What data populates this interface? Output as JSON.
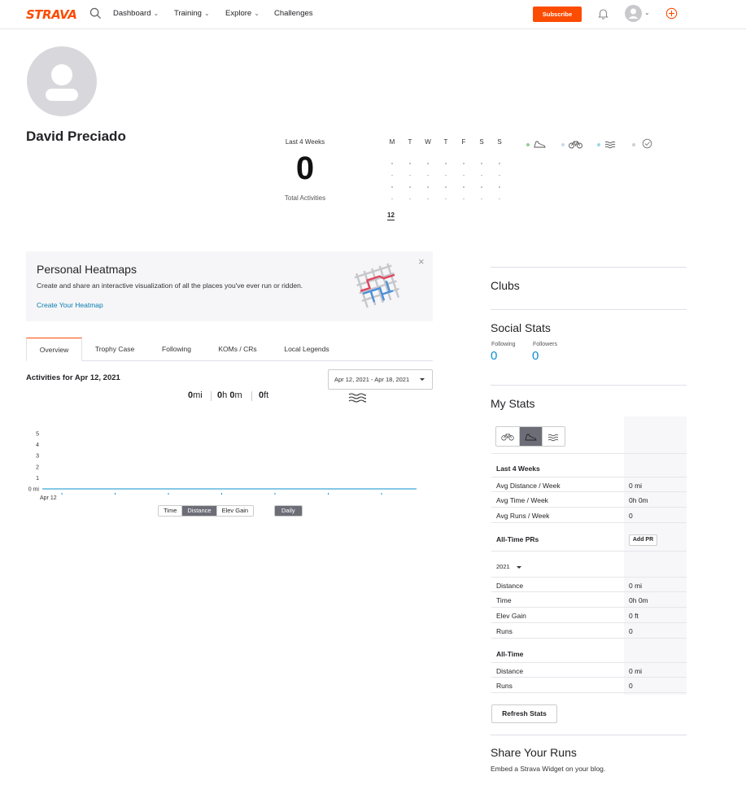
{
  "header": {
    "logo": "STRAVA",
    "nav": [
      {
        "label": "Dashboard",
        "has_dropdown": true
      },
      {
        "label": "Training",
        "has_dropdown": true
      },
      {
        "label": "Explore",
        "has_dropdown": true
      },
      {
        "label": "Challenges",
        "has_dropdown": false
      }
    ],
    "subscribe_label": "Subscribe",
    "accent": "#fc4c02"
  },
  "profile": {
    "name": "David Preciado",
    "last4weeks_label": "Last 4 Weeks",
    "last4weeks_count": "0",
    "total_activities_label": "Total Activities",
    "week_days": [
      "M",
      "T",
      "W",
      "T",
      "F",
      "S",
      "S"
    ],
    "calendar_date": "12",
    "sport_legend": [
      {
        "icon": "run-shoe-icon",
        "color": "#8fd18f"
      },
      {
        "icon": "bike-icon",
        "color": "#cfd8e8"
      },
      {
        "icon": "swim-icon",
        "color": "#9fd6ea"
      },
      {
        "icon": "other-activity-icon",
        "color": "#cfcfd4"
      }
    ]
  },
  "heatmap_banner": {
    "title": "Personal Heatmaps",
    "description": "Create and share an interactive visualization of all the places you've ever run or ridden.",
    "link": "Create Your Heatmap"
  },
  "tabs": [
    "Overview",
    "Trophy Case",
    "Following",
    "KOMs / CRs",
    "Local Legends"
  ],
  "activities": {
    "title": "Activities for Apr 12, 2021",
    "date_range": "Apr 12, 2021 - Apr 18, 2021",
    "summary": [
      {
        "num": "0",
        "unit": "mi"
      },
      {
        "num": "0",
        "unit": "h",
        "num2": "0",
        "unit2": "m"
      },
      {
        "num": "0",
        "unit": "ft"
      }
    ],
    "metric_toggle": [
      "Time",
      "Distance",
      "Elev Gain"
    ],
    "metric_selected": "Distance",
    "period_toggle": "Daily"
  },
  "chart_data": {
    "type": "line",
    "y_ticks": [
      "5",
      "4",
      "3",
      "2",
      "1",
      "0 mi"
    ],
    "ylim": [
      0,
      5
    ],
    "x_labels": [
      "Apr 12"
    ],
    "series": [
      {
        "values": [
          0,
          0,
          0,
          0,
          0,
          0,
          0
        ]
      }
    ],
    "line_color": "#0a8fd0"
  },
  "sidebar": {
    "clubs_title": "Clubs",
    "social_title": "Social Stats",
    "following_label": "Following",
    "following_value": "0",
    "followers_label": "Followers",
    "followers_value": "0",
    "my_stats_title": "My Stats",
    "last4_title": "Last 4 Weeks",
    "last4_rows": [
      {
        "label": "Avg Distance / Week",
        "value": "0 mi"
      },
      {
        "label": "Avg Time / Week",
        "value": "0h 0m"
      },
      {
        "label": "Avg Runs / Week",
        "value": "0"
      }
    ],
    "pr_title": "All-Time PRs",
    "add_pr_label": "Add PR",
    "year": "2021",
    "year_rows": [
      {
        "label": "Distance",
        "value": "0 mi"
      },
      {
        "label": "Time",
        "value": "0h 0m"
      },
      {
        "label": "Elev Gain",
        "value": "0 ft"
      },
      {
        "label": "Runs",
        "value": "0"
      }
    ],
    "alltime_title": "All-Time",
    "alltime_rows": [
      {
        "label": "Distance",
        "value": "0 mi"
      },
      {
        "label": "Runs",
        "value": "0"
      }
    ],
    "refresh_label": "Refresh Stats",
    "share_title": "Share Your Runs",
    "share_sub": "Embed a Strava Widget on your blog."
  }
}
